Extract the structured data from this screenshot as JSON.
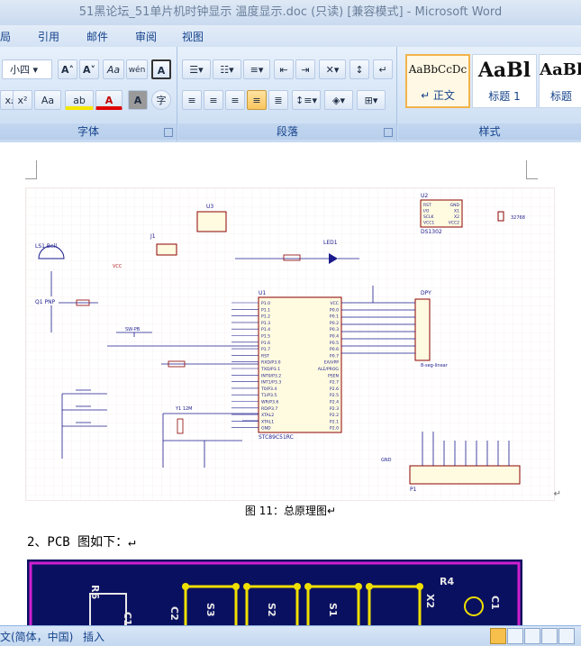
{
  "window": {
    "title": "51黑论坛_51单片机时钟显示 温度显示.doc (只读) [兼容模式] - Microsoft Word"
  },
  "menu": {
    "items": [
      "局",
      "引用",
      "邮件",
      "审阅",
      "视图"
    ]
  },
  "ribbon": {
    "font_size": "小四",
    "font_group_label": "字体",
    "paragraph_group_label": "段落",
    "styles_group_label": "样式",
    "styles": [
      {
        "sample": "AaBbCcDc",
        "name": "↵ 正文"
      },
      {
        "sample": "AaBl",
        "name": "标题 1"
      },
      {
        "sample": "AaBl",
        "name": "标题"
      }
    ],
    "buttons": {
      "grow_font": "A˄",
      "shrink_font": "A˅",
      "clear_format": "Aa",
      "phonetic": "wén",
      "char_border": "A",
      "subscript": "x₂",
      "superscript": "x²",
      "change_case": "Aa",
      "highlight": "ab",
      "font_color": "A",
      "char_shading": "A",
      "enclose": "字"
    }
  },
  "document": {
    "figure_caption": "图 11：总原理图↵",
    "heading": "2、PCB 图如下：↵",
    "schematic": {
      "u1_label": "U1",
      "u1_part": "STC89C51RC",
      "p1_label": "P1",
      "j1_label": "J1",
      "u2_label": "U2",
      "u2_part": "DS1302",
      "u3_label": "U3",
      "led_label": "LED1",
      "gnd": "GND",
      "vcc": "VCC",
      "ds1302_pins": [
        "RST",
        "I/O",
        "SCLK",
        "VCC1",
        "GND",
        "X1",
        "X2",
        "VCC2"
      ],
      "crystal": "32768",
      "u1_left_pins": [
        "P1.0",
        "P1.1",
        "P1.2",
        "P1.3",
        "P1.4",
        "P1.5",
        "P1.6",
        "P1.7",
        "RST",
        "RXD/P3.0",
        "TXD/P3.1",
        "INT0/P3.2",
        "INT1/P3.3",
        "T0/P3.4",
        "T1/P3.5",
        "WR/P3.6",
        "RD/P3.7",
        "XTAL2",
        "XTAL1",
        "GND"
      ],
      "u1_right_pins": [
        "VCC",
        "P0.0",
        "P0.1",
        "P0.2",
        "P0.3",
        "P0.4",
        "P0.5",
        "P0.6",
        "P0.7",
        "EA/VPP",
        "ALE/PROG",
        "PSEN",
        "P2.7",
        "P2.6",
        "P2.5",
        "P2.4",
        "P2.3",
        "P2.2",
        "P2.1",
        "P2.0"
      ],
      "dpy_label": "DPY",
      "dpy_part": "8-seg-linear",
      "sw_label": "SW-PB",
      "r_labels": [
        "R1 1K",
        "R2",
        "R3 10K",
        "R4 10K"
      ],
      "c_labels": [
        "C1 10uF",
        "C2 30pF",
        "C3 30pF"
      ],
      "y1_label": "Y1 12M",
      "q1_label": "Q1 PNP",
      "ls1_label": "LS1 Bell"
    },
    "pcb_labels": [
      "R6",
      "C1",
      "C2",
      "S3",
      "S2",
      "S1",
      "R4",
      "X2",
      "C1"
    ]
  },
  "status": {
    "language": "文(简体，中国)",
    "mode": "插入"
  },
  "colors": {
    "ribbon_bg": "#d6e5f6",
    "accent": "#15428b",
    "pcb_bg": "#0a1060",
    "schematic_wire": "#1a1a8c",
    "schematic_red": "#b22222"
  }
}
